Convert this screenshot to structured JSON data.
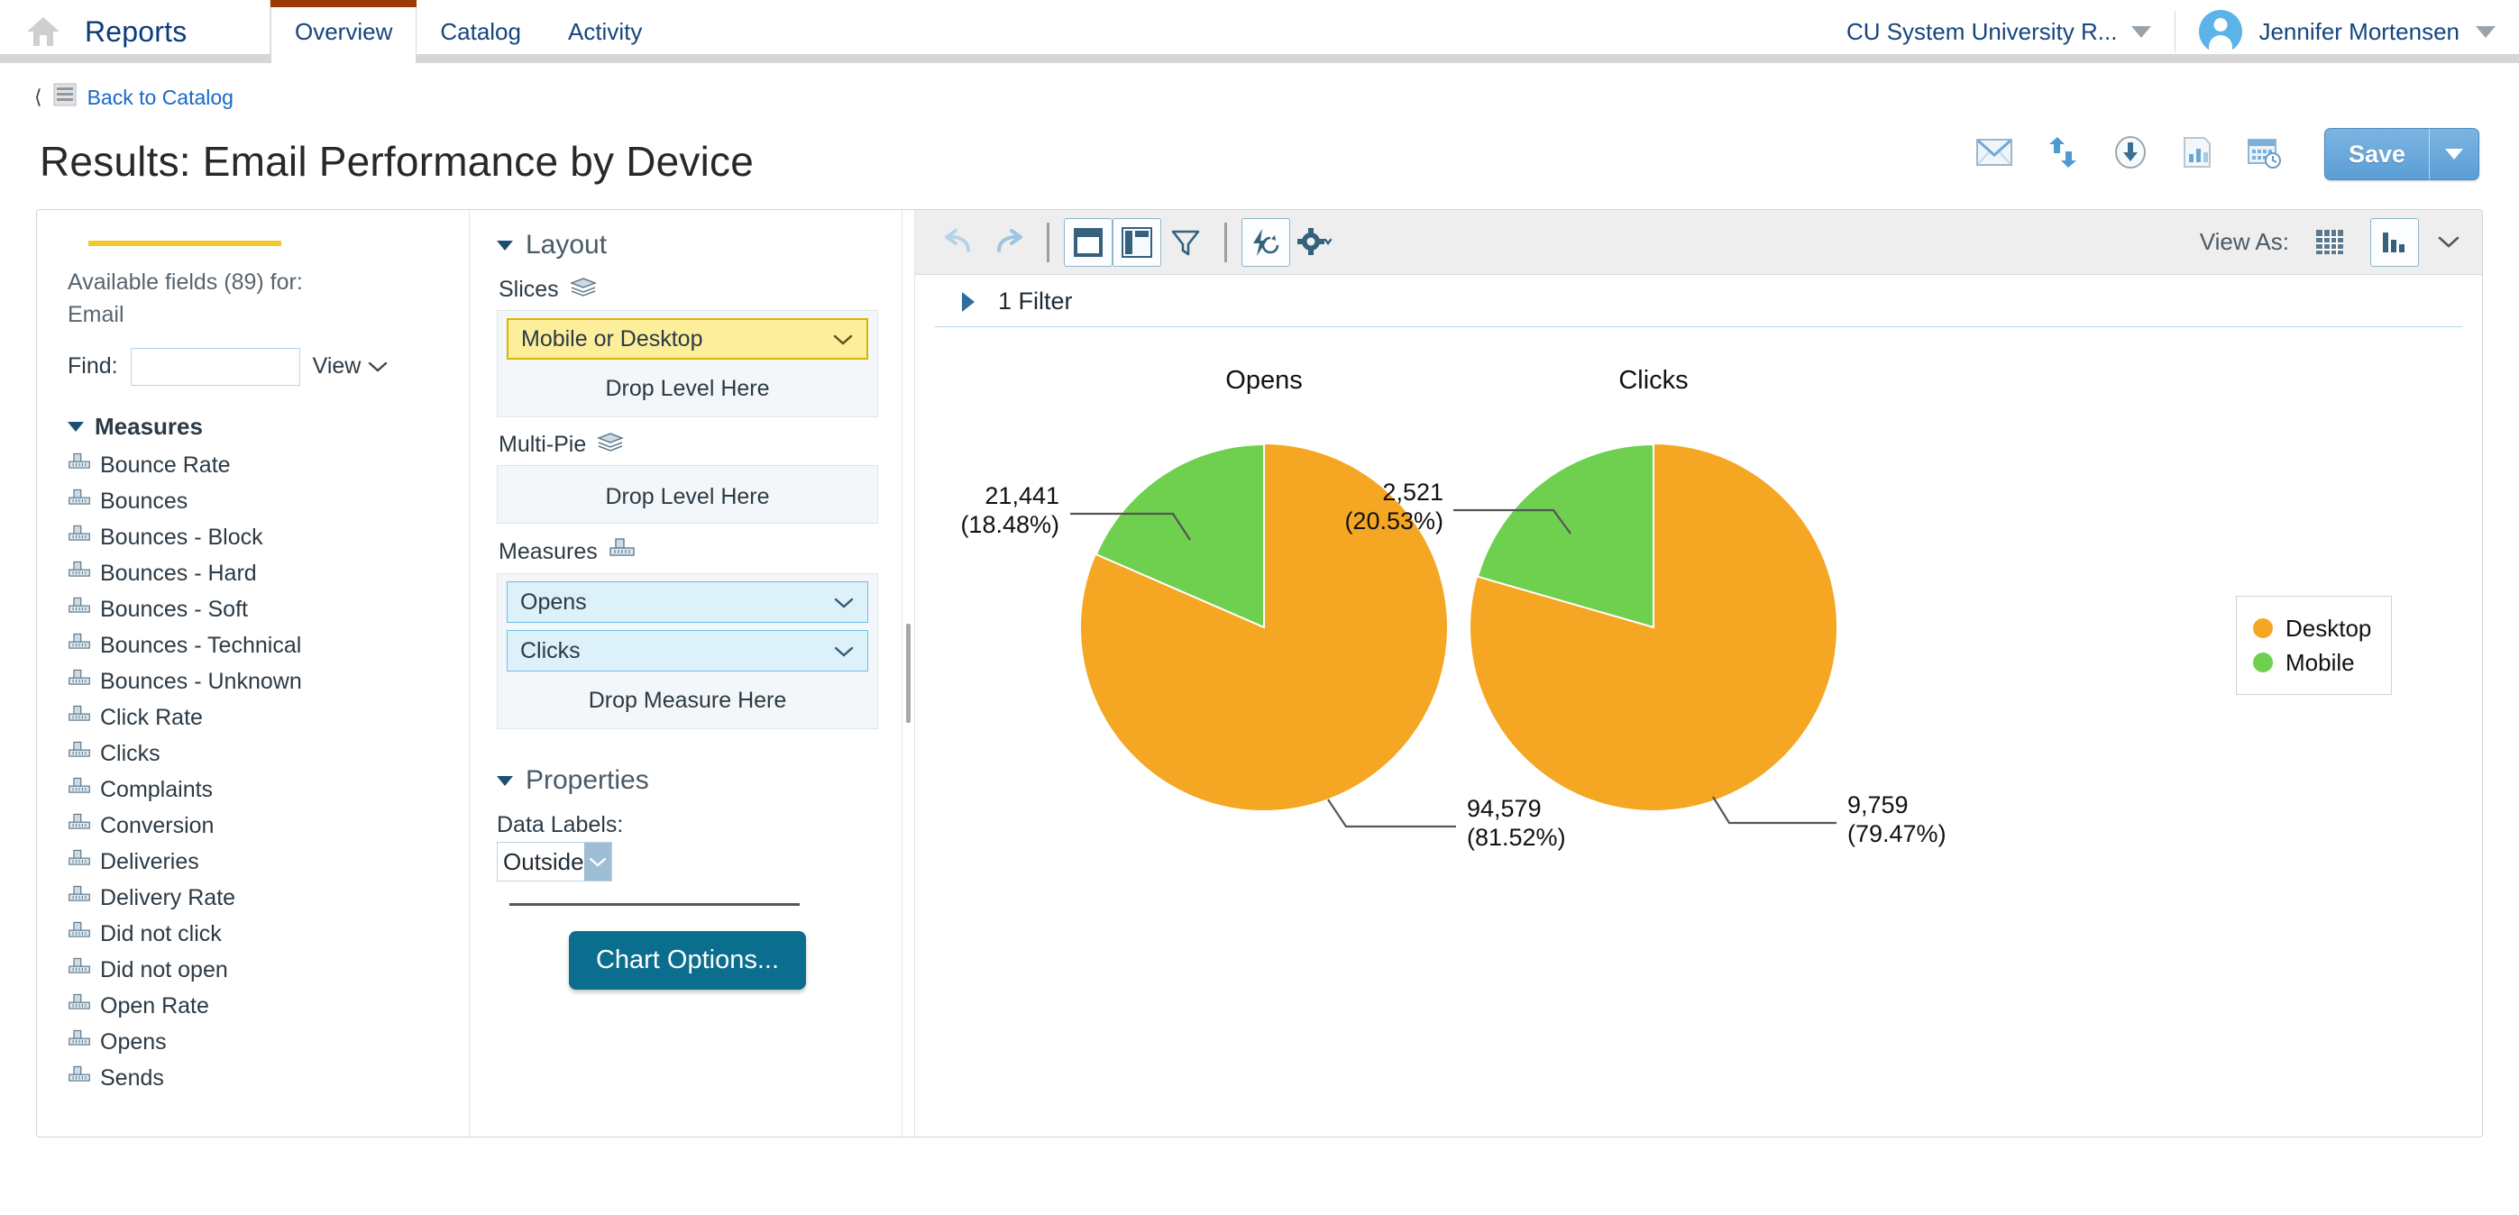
{
  "topnav": {
    "home_label": "Reports",
    "tabs": [
      {
        "label": "Overview",
        "active": true
      },
      {
        "label": "Catalog",
        "active": false
      },
      {
        "label": "Activity",
        "active": false
      }
    ],
    "org": "CU System University R...",
    "user": "Jennifer Mortensen"
  },
  "breadcrumb": {
    "back_label": "Back to Catalog"
  },
  "header": {
    "title": "Results: Email Performance by Device",
    "save_label": "Save",
    "actions": [
      "email-icon",
      "share-icon",
      "download-icon",
      "chart-report-icon",
      "schedule-icon"
    ]
  },
  "fields": {
    "heading_line1": "Available fields (89) for:",
    "heading_line2": "Email",
    "find_label": "Find:",
    "find_value": "",
    "find_placeholder": "",
    "view_label": "View",
    "group_label": "Measures",
    "items": [
      "Bounce Rate",
      "Bounces",
      "Bounces - Block",
      "Bounces - Hard",
      "Bounces - Soft",
      "Bounces - Technical",
      "Bounces - Unknown",
      "Click Rate",
      "Clicks",
      "Complaints",
      "Conversion",
      "Deliveries",
      "Delivery Rate",
      "Did not click",
      "Did not open",
      "Open Rate",
      "Opens",
      "Sends"
    ]
  },
  "layout": {
    "section_title": "Layout",
    "slices_label": "Slices",
    "slices_chip": "Mobile or Desktop",
    "slices_drop_hint": "Drop Level Here",
    "multipie_label": "Multi-Pie",
    "multipie_drop_hint": "Drop Level Here",
    "measures_label": "Measures",
    "measure_chips": [
      "Opens",
      "Clicks"
    ],
    "measures_drop_hint": "Drop Measure Here"
  },
  "properties": {
    "section_title": "Properties",
    "data_labels_label": "Data Labels:",
    "data_labels_value": "Outside",
    "chart_options_label": "Chart Options..."
  },
  "chart_toolbar": {
    "undo": "undo-icon",
    "redo": "redo-icon",
    "view_as_label": "View As:"
  },
  "filter_bar": {
    "label": "1 Filter"
  },
  "chart_data": {
    "type": "pie",
    "title": "",
    "legend_position": "right",
    "legend": [
      {
        "name": "Desktop",
        "color": "#f5a623"
      },
      {
        "name": "Mobile",
        "color": "#6ed04e"
      }
    ],
    "categories": [
      "Desktop",
      "Mobile"
    ],
    "charts": [
      {
        "title": "Opens",
        "slices": [
          {
            "name": "Desktop",
            "value": 94579,
            "value_label": "94,579",
            "percent": 81.52,
            "percent_label": "(81.52%)",
            "color": "#f5a623"
          },
          {
            "name": "Mobile",
            "value": 21441,
            "value_label": "21,441",
            "percent": 18.48,
            "percent_label": "(18.48%)",
            "color": "#6ed04e"
          }
        ]
      },
      {
        "title": "Clicks",
        "slices": [
          {
            "name": "Desktop",
            "value": 9759,
            "value_label": "9,759",
            "percent": 79.47,
            "percent_label": "(79.47%)",
            "color": "#f5a623"
          },
          {
            "name": "Mobile",
            "value": 2521,
            "value_label": "2,521",
            "percent": 20.53,
            "percent_label": "(20.53%)",
            "color": "#6ed04e"
          }
        ]
      }
    ]
  }
}
